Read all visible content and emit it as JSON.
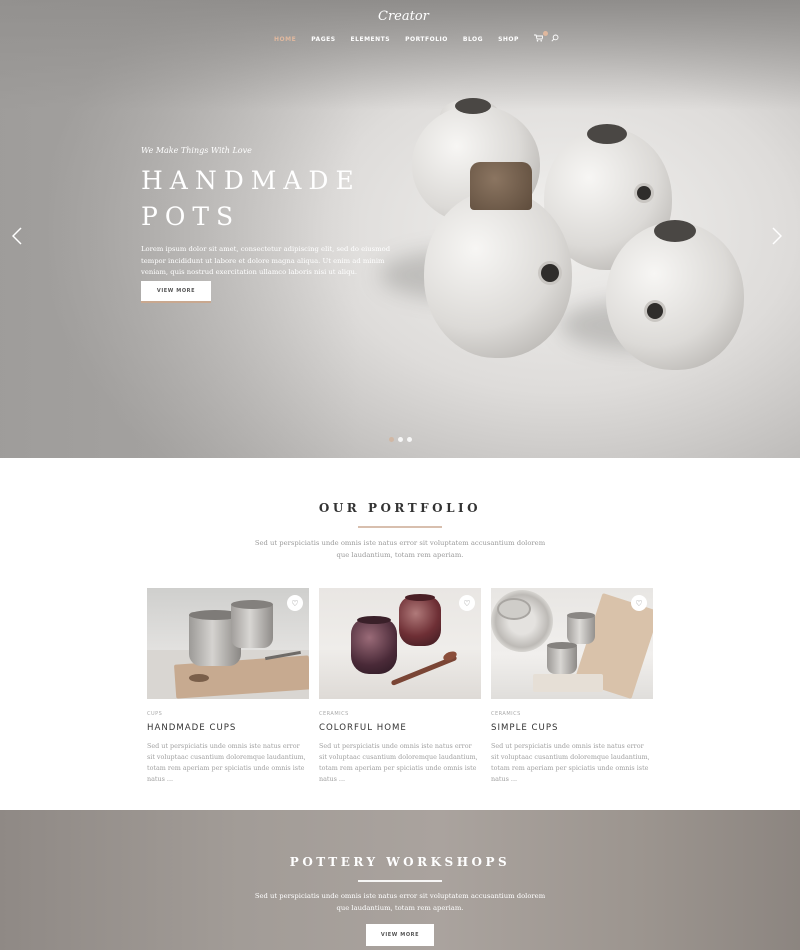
{
  "brand": {
    "logo_text": "Creator"
  },
  "nav": {
    "items": [
      {
        "label": "HOME",
        "active": true
      },
      {
        "label": "PAGES"
      },
      {
        "label": "ELEMENTS"
      },
      {
        "label": "PORTFOLIO"
      },
      {
        "label": "BLOG"
      },
      {
        "label": "SHOP"
      }
    ],
    "icons": [
      "cart-icon",
      "search-icon"
    ]
  },
  "hero": {
    "tagline": "We Make Things With Love",
    "title_line1": "HANDMADE",
    "title_line2": "POTS",
    "description": "Lorem ipsum dolor sit amet, consectetur adipiscing elit, sed do eiusmod tempor incididunt ut labore et dolore magna aliqua. Ut enim ad minim veniam, quis nostrud exercitation ullamco laboris nisi ut aliqu.",
    "button_label": "VIEW MORE",
    "slides": 3,
    "active_slide": 1
  },
  "portfolio": {
    "title": "OUR PORTFOLIO",
    "subtitle": "Sed ut perspiciatis unde omnis iste natus error sit voluptatem accusantium dolorem que laudantium, totam rem aperiam.",
    "cards": [
      {
        "category": "CUPS",
        "title": "HANDMADE CUPS",
        "text": "Sed ut perspiciatis unde omnis iste natus error sit voluptaac cusantium doloremque laudantium, totam rem aperiam per spiciatis unde omnis iste natus ..."
      },
      {
        "category": "CERAMICS",
        "title": "COLORFUL HOME",
        "text": "Sed ut perspiciatis unde omnis iste natus error sit voluptaac cusantium doloremque laudantium, totam rem aperiam per spiciatis unde omnis iste natus ..."
      },
      {
        "category": "CERAMICS",
        "title": "SIMPLE CUPS",
        "text": "Sed ut perspiciatis unde omnis iste natus error sit voluptaac cusantium doloremque laudantium, totam rem aperiam per spiciatis unde omnis iste natus ..."
      }
    ]
  },
  "workshops": {
    "title": "POTTERY WORKSHOPS",
    "subtitle": "Sed ut perspiciatis unde omnis iste natus error sit voluptatem accusantium dolorem que laudantium, totam rem aperiam.",
    "button_label": "VIEW MORE"
  },
  "colors": {
    "accent": "#d2b49e",
    "text_dark": "#333333",
    "text_muted": "#9a9a9a"
  }
}
